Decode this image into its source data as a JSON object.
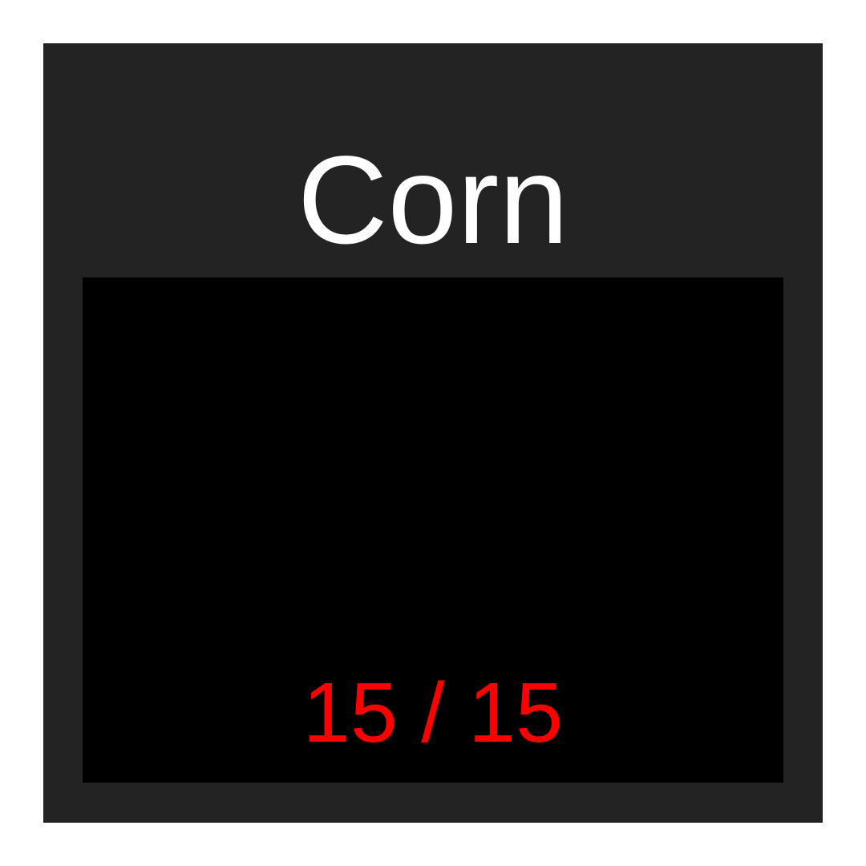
{
  "card": {
    "title": "Corn",
    "background_color": "#232323"
  },
  "screen": {
    "background_color": "#000000",
    "counter": {
      "current": "15",
      "total": "15",
      "text": "15 / 15",
      "color": "#ff0000"
    }
  }
}
